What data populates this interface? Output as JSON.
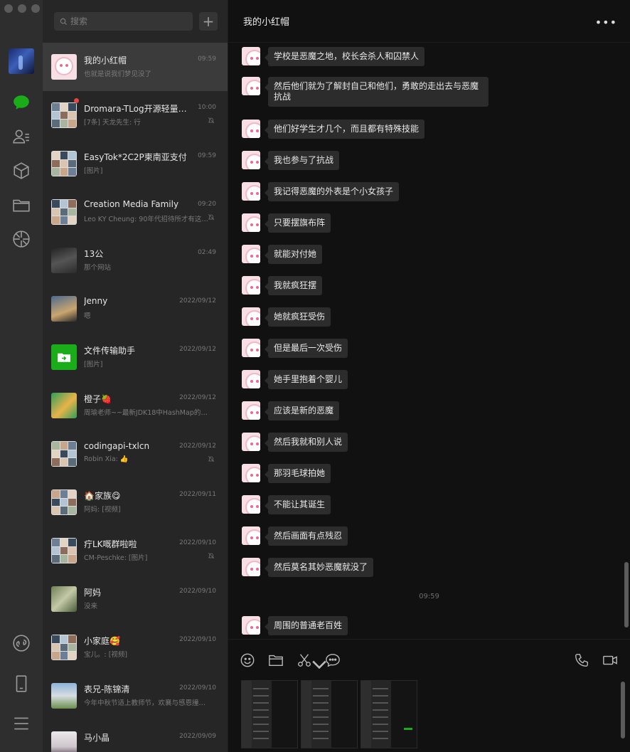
{
  "sidebar": {
    "icons": [
      "chat-icon",
      "contacts-icon",
      "favorites-icon",
      "files-icon",
      "moments-icon",
      "mini-program-icon",
      "phone-icon",
      "menu-icon"
    ]
  },
  "search": {
    "placeholder": "搜索"
  },
  "conversations": [
    {
      "name": "我的小红帽",
      "time": "09:59",
      "preview": "也就是说我们梦见没了",
      "muted": false,
      "avatar": "pink"
    },
    {
      "name": "Dromara-TLog开源轻量级日...",
      "time": "10:00",
      "preview": "[7条] 天龙先生: 行",
      "muted": true,
      "unread": true,
      "avatar": "grid"
    },
    {
      "name": "EasyTok*2C2P柬南亚支付",
      "time": "09:59",
      "preview": "[图片]",
      "muted": false,
      "avatar": "grid"
    },
    {
      "name": "Creation Media Family",
      "time": "09:20",
      "preview": "Leo KY Cheung: 90年代招待所才有这個...",
      "muted": true,
      "avatar": "grid"
    },
    {
      "name": "13公",
      "time": "02:49",
      "preview": "那个网站",
      "muted": false,
      "avatar": "photo1"
    },
    {
      "name": "Jenny",
      "time": "2022/09/12",
      "preview": "嗯",
      "muted": false,
      "avatar": "photo2"
    },
    {
      "name": "文件传输助手",
      "time": "2022/09/12",
      "preview": "[图片]",
      "muted": false,
      "avatar": "green"
    },
    {
      "name": "橙子🍓",
      "time": "2022/09/12",
      "preview": "周瑜老师~~最新JDK18中HashMap的底层...",
      "muted": false,
      "avatar": "cat"
    },
    {
      "name": "codingapi-txlcn",
      "time": "2022/09/12",
      "preview": "Robin Xia: 👍",
      "muted": true,
      "avatar": "grid"
    },
    {
      "name": "🏠家族😋",
      "time": "2022/09/11",
      "preview": "阿妈: [视频]",
      "muted": false,
      "avatar": "grid"
    },
    {
      "name": "疔LK嘅群啦啦",
      "time": "2022/09/10",
      "preview": "CM-Peschke: [图片]",
      "muted": true,
      "avatar": "grid"
    },
    {
      "name": "阿妈",
      "time": "2022/09/10",
      "preview": "没来",
      "muted": false,
      "avatar": "leaf"
    },
    {
      "name": "小家庭🥰",
      "time": "2022/09/10",
      "preview": "宝儿。: [视频]",
      "muted": false,
      "avatar": "grid"
    },
    {
      "name": "表兄-陈锦清",
      "time": "2022/09/10",
      "preview": "今年中秋节适上教师节，欢襄与感恩撞个满...",
      "muted": false,
      "avatar": "out"
    },
    {
      "name": "马小晶",
      "time": "2022/09/09",
      "preview": "",
      "muted": false,
      "avatar": "girl"
    }
  ],
  "chat": {
    "title": "我的小红帽",
    "more_label": "•••",
    "messages": [
      {
        "text": "学校是恶魔之地，校长会杀人和囚禁人"
      },
      {
        "text": "然后他们就为了解封自己和他们，勇敢的走出去与恶魔抗战"
      },
      {
        "text": "他们好学生才几个，而且都有特殊技能"
      },
      {
        "text": "我也参与了抗战"
      },
      {
        "text": "我记得恶魔的外表是个小女孩子"
      },
      {
        "text": "只要摆旗布阵"
      },
      {
        "text": "就能对付她"
      },
      {
        "text": "我就疯狂摆"
      },
      {
        "text": "她就疯狂受伤"
      },
      {
        "text": "但是最后一次受伤"
      },
      {
        "text": "她手里抱着个婴儿"
      },
      {
        "text": "应该是新的恶魔"
      },
      {
        "text": "然后我就和别人说"
      },
      {
        "text": "那羽毛球拍她"
      },
      {
        "text": "不能让其诞生"
      },
      {
        "text": "然后画面有点残忍"
      },
      {
        "text": "然后莫名其妙恶魔就没了"
      }
    ],
    "timestamp": "09:59",
    "last_message": {
      "text": "周围的普通老百姓"
    }
  },
  "toolbar": {
    "icons": [
      "emoji-icon",
      "folder-icon",
      "scissors-icon",
      "chat-bubble-icon",
      "phone-call-icon",
      "video-call-icon"
    ]
  },
  "colors": {
    "rail": "#2e2e2e",
    "list": "#262626",
    "active_item": "#3b3b3b",
    "chat_bg": "#111111",
    "bubble": "#2c2c2c",
    "wechat_green": "#1aad19",
    "unread": "#e54545"
  }
}
